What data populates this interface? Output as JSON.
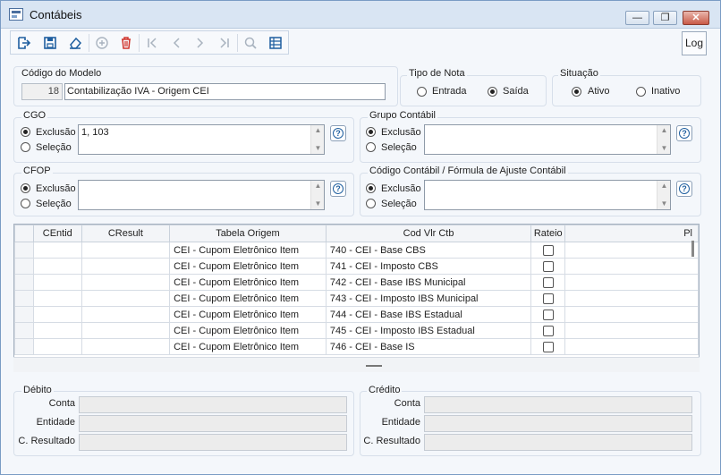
{
  "window": {
    "title": "Contábeis",
    "minimize": "—",
    "maximize": "❐",
    "close": "✕"
  },
  "toolbar": {
    "log_label": "Log"
  },
  "codigo_modelo": {
    "label": "Código do Modelo",
    "number": "18",
    "description": "Contabilização IVA - Origem CEI"
  },
  "tipo_nota": {
    "label": "Tipo de Nota",
    "options": [
      "Entrada",
      "Saída"
    ],
    "selected": "Saída"
  },
  "situacao": {
    "label": "Situação",
    "options": [
      "Ativo",
      "Inativo"
    ],
    "selected": "Ativo"
  },
  "cgo": {
    "label": "CGO",
    "exclusion": "Exclusão",
    "selection": "Seleção",
    "value": "1, 103"
  },
  "grupo_contabil": {
    "label": "Grupo Contábil",
    "exclusion": "Exclusão",
    "selection": "Seleção",
    "value": ""
  },
  "cfop": {
    "label": "CFOP",
    "exclusion": "Exclusão",
    "selection": "Seleção",
    "value": ""
  },
  "codigo_contabil": {
    "label": "Código Contábil / Fórmula de Ajuste Contábil",
    "exclusion": "Exclusão",
    "selection": "Seleção",
    "value": ""
  },
  "table": {
    "columns": [
      "CEntid",
      "CResult",
      "Tabela Origem",
      "Cod Vlr Ctb",
      "Rateio",
      "Pl"
    ],
    "rows": [
      {
        "centid": "",
        "cresult": "",
        "tabela": "CEI - Cupom Eletrônico Item",
        "cod": "740 - CEI - Base CBS",
        "rateio": false
      },
      {
        "centid": "",
        "cresult": "",
        "tabela": "CEI - Cupom Eletrônico Item",
        "cod": "741 - CEI - Imposto CBS",
        "rateio": false
      },
      {
        "centid": "",
        "cresult": "",
        "tabela": "CEI - Cupom Eletrônico Item",
        "cod": "742 - CEI - Base IBS Municipal",
        "rateio": false
      },
      {
        "centid": "",
        "cresult": "",
        "tabela": "CEI - Cupom Eletrônico Item",
        "cod": "743 - CEI - Imposto IBS Municipal",
        "rateio": false
      },
      {
        "centid": "",
        "cresult": "",
        "tabela": "CEI - Cupom Eletrônico Item",
        "cod": "744 - CEI - Base IBS Estadual",
        "rateio": false
      },
      {
        "centid": "",
        "cresult": "",
        "tabela": "CEI - Cupom Eletrônico Item",
        "cod": "745 - CEI - Imposto IBS Estadual",
        "rateio": false
      },
      {
        "centid": "",
        "cresult": "",
        "tabela": "CEI - Cupom Eletrônico Item",
        "cod": "746 - CEI - Base IS",
        "rateio": false
      }
    ]
  },
  "debito": {
    "label": "Débito",
    "conta": "Conta",
    "entidade": "Entidade",
    "resultado": "C. Resultado"
  },
  "credito": {
    "label": "Crédito",
    "conta": "Conta",
    "entidade": "Entidade",
    "resultado": "C. Resultado"
  }
}
